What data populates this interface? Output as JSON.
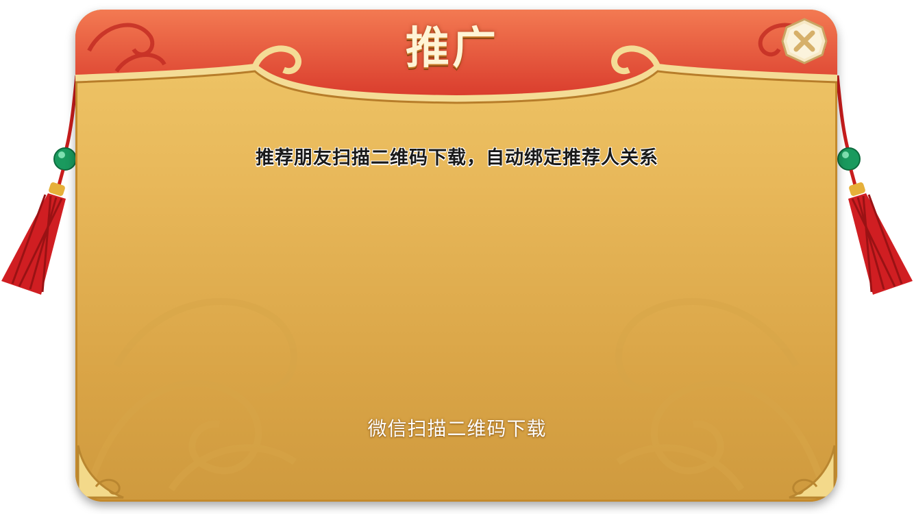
{
  "dialog": {
    "title": "推广",
    "close_icon": "close-icon",
    "subtitle": "推荐朋友扫描二维码下载，自动绑定推荐人关系",
    "qr_label": "微信扫描二维码下载"
  },
  "colors": {
    "header_red": "#e24a35",
    "parchment": "#e8b85a",
    "gold_trim": "#f3dc98",
    "tassel_red": "#d41e22",
    "jade": "#1fae6b"
  }
}
